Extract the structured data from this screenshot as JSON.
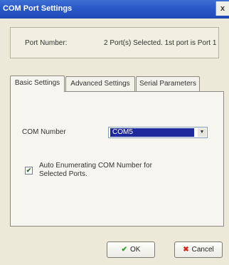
{
  "window": {
    "title": "COM Port Settings",
    "close_glyph": "x"
  },
  "port": {
    "label": "Port Number:",
    "value": "2 Port(s) Selected. 1st port is Port 1"
  },
  "tabs": [
    {
      "label": "Basic Settings",
      "active": true
    },
    {
      "label": "Advanced Settings",
      "active": false
    },
    {
      "label": "Serial Parameters",
      "active": false
    }
  ],
  "basic": {
    "com_number_label": "COM Number",
    "com_number_value": "COM5",
    "auto_enum_checked": true,
    "auto_enum_label_line1": "Auto Enumerating COM Number for",
    "auto_enum_label_line2": "Selected Ports."
  },
  "buttons": {
    "ok_label": "OK",
    "ok_icon": "check-icon",
    "cancel_label": "Cancel",
    "cancel_icon": "x-icon"
  }
}
